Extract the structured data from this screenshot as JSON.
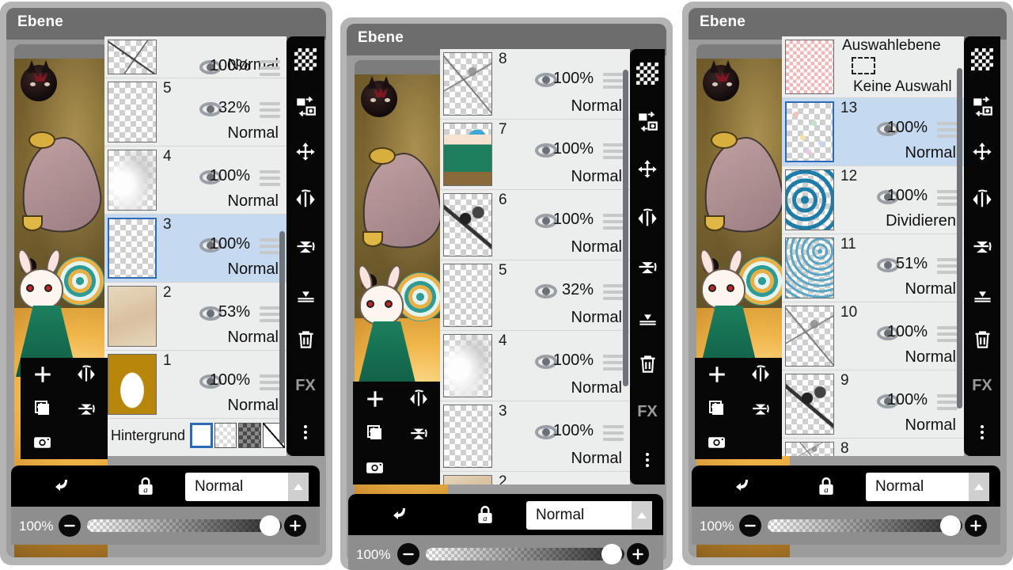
{
  "app": {
    "title": "Ebene",
    "blend_normal": "Normal",
    "blend_divide": "Dividieren",
    "background_label": "Hintergrund",
    "selection_layer_title": "Auswahlebene",
    "selection_layer_subtitle": "Keine Auswahl",
    "opacity_value": "100%",
    "fx_label": "FX",
    "accent_selected": "#c5d9f1",
    "accent_border": "#2d6ab5",
    "panel_bg": "#b4b4b4",
    "list_bg": "#eceded"
  },
  "icons": {
    "checker": "checkerboard-icon",
    "swap": "swap-layer-icon",
    "move": "move-icon",
    "flip_h": "flip-horizontal-icon",
    "flip_v": "flip-vertical-icon",
    "merge_down": "merge-down-icon",
    "trash": "trash-icon",
    "fx": "fx-icon",
    "more": "more-options-icon",
    "add": "add-layer-icon",
    "duplicate": "duplicate-layer-icon",
    "camera": "camera-icon",
    "clip": "clipping-mask-icon",
    "alpha_lock": "alpha-lock-icon",
    "minus": "minus-icon",
    "plus": "plus-icon",
    "eye": "visibility-eye-icon",
    "handle": "drag-handle-icon",
    "chevron_up": "chevron-up-icon"
  },
  "panels": [
    {
      "id": "panel-left",
      "title": "Ebene",
      "layers": [
        {
          "num": "",
          "opacity": "100%",
          "blend": "Normal",
          "selected": false,
          "thumb": "tArtLine",
          "partial_top": true
        },
        {
          "num": "5",
          "opacity": "32%",
          "blend": "Normal",
          "selected": false,
          "thumb": "plain"
        },
        {
          "num": "4",
          "opacity": "100%",
          "blend": "Normal",
          "selected": false,
          "thumb": "tCloud"
        },
        {
          "num": "3",
          "opacity": "100%",
          "blend": "Normal",
          "selected": true,
          "thumb": "plain"
        },
        {
          "num": "2",
          "opacity": "53%",
          "blend": "Normal",
          "selected": false,
          "thumb": "tBeige"
        },
        {
          "num": "1",
          "opacity": "100%",
          "blend": "Normal",
          "selected": false,
          "thumb": "tGoldCat"
        }
      ],
      "background_label": "Hintergrund",
      "background_swatches": [
        "white",
        "checker-light",
        "checker-dark",
        "diagonal"
      ],
      "background_selected_index": 0,
      "bottom": {
        "blend": "Normal",
        "opacity": "100%"
      }
    },
    {
      "id": "panel-middle",
      "title": "Ebene",
      "layers": [
        {
          "num": "8",
          "opacity": "100%",
          "blend": "Normal",
          "selected": false,
          "thumb": "tSketch"
        },
        {
          "num": "7",
          "opacity": "100%",
          "blend": "Normal",
          "selected": false,
          "thumb": "tGirl"
        },
        {
          "num": "6",
          "opacity": "100%",
          "blend": "Normal",
          "selected": false,
          "thumb": "tInk"
        },
        {
          "num": "5",
          "opacity": "32%",
          "blend": "Normal",
          "selected": false,
          "thumb": "plain"
        },
        {
          "num": "4",
          "opacity": "100%",
          "blend": "Normal",
          "selected": false,
          "thumb": "tCloud"
        },
        {
          "num": "3",
          "opacity": "100%",
          "blend": "Normal",
          "selected": false,
          "thumb": "plain"
        },
        {
          "num": "2",
          "opacity": "",
          "blend": "",
          "selected": false,
          "thumb": "tBeige",
          "partial_bottom": true
        }
      ],
      "bottom": {
        "blend": "Normal",
        "opacity": "100%"
      }
    },
    {
      "id": "panel-right",
      "title": "Ebene",
      "selection_layer": {
        "title": "Auswahlebene",
        "subtitle": "Keine Auswahl"
      },
      "layers": [
        {
          "num": "13",
          "opacity": "100%",
          "blend": "Normal",
          "selected": true,
          "thumb": "tConfetti"
        },
        {
          "num": "12",
          "opacity": "100%",
          "blend": "Dividieren",
          "selected": false,
          "thumb": "tWave"
        },
        {
          "num": "11",
          "opacity": "51%",
          "blend": "Normal",
          "selected": false,
          "thumb": "tRipple"
        },
        {
          "num": "10",
          "opacity": "100%",
          "blend": "Normal",
          "selected": false,
          "thumb": "tSketch"
        },
        {
          "num": "9",
          "opacity": "100%",
          "blend": "Normal",
          "selected": false,
          "thumb": "tInk"
        },
        {
          "num": "8",
          "opacity": "",
          "blend": "",
          "selected": false,
          "thumb": "tSketch",
          "partial_bottom": true
        }
      ],
      "bottom": {
        "blend": "Normal",
        "opacity": "100%"
      }
    }
  ]
}
